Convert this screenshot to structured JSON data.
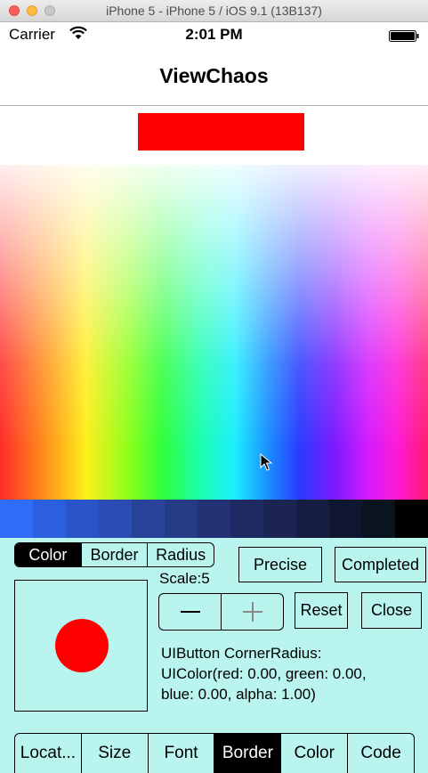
{
  "window": {
    "title": "iPhone 5 - iPhone 5 / iOS 9.1 (13B137)"
  },
  "status_bar": {
    "carrier": "Carrier",
    "time": "2:01 PM",
    "wifi_icon": "wifi-icon",
    "battery_icon": "battery-icon"
  },
  "nav": {
    "title": "ViewChaos"
  },
  "preview": {
    "red_rect_color": "#ff0000",
    "circle_color": "#ff0000"
  },
  "spectrum": {
    "shade_strip": [
      "#2f6cf7",
      "#2c5fdd",
      "#2a55c8",
      "#2a4db4",
      "#284399",
      "#253b86",
      "#223275",
      "#1f2a63",
      "#1b2452",
      "#151d40",
      "#0f162f",
      "#0a141e",
      "#000000"
    ]
  },
  "panel": {
    "background": "#b9f4ef",
    "mode_tabs": [
      {
        "label": "Color",
        "selected": true
      },
      {
        "label": "Border",
        "selected": false
      },
      {
        "label": "Radius",
        "selected": false
      }
    ],
    "precise_label": "Precise",
    "completed_label": "Completed",
    "scale_label": "Scale:5",
    "reset_label": "Reset",
    "close_label": "Close",
    "stepper": {
      "minus_icon": "minus-icon",
      "plus_icon": "plus-icon"
    },
    "info_line1": "UIButton CornerRadius:",
    "info_line2": "UIColor(red: 0.00, green: 0.00,",
    "info_line3": "blue: 0.00, alpha: 1.00)"
  },
  "bottom_tabs": [
    {
      "label": "Locat...",
      "selected": false
    },
    {
      "label": "Size",
      "selected": false
    },
    {
      "label": "Font",
      "selected": false
    },
    {
      "label": "Border",
      "selected": true
    },
    {
      "label": "Color",
      "selected": false
    },
    {
      "label": "Code",
      "selected": false
    }
  ]
}
